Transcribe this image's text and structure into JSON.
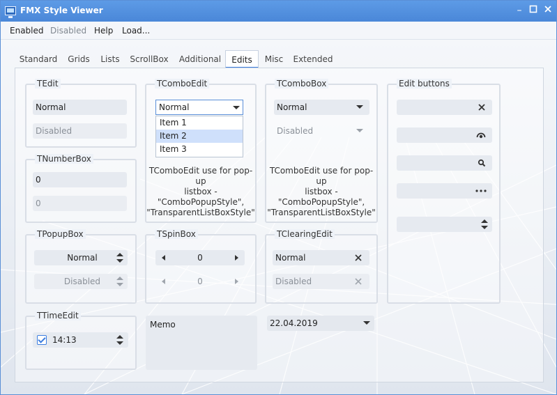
{
  "window": {
    "title": "FMX Style Viewer"
  },
  "menu": [
    "Enabled",
    "Disabled",
    "Help",
    "Load..."
  ],
  "tabs": [
    "Standard",
    "Grids",
    "Lists",
    "ScrollBox",
    "Additional",
    "Edits",
    "Misc",
    "Extended"
  ],
  "active_tab": "Edits",
  "groups": {
    "tedit": {
      "title": "TEdit",
      "normal": "Normal",
      "disabled": "Disabled"
    },
    "tnumberbox": {
      "title": "TNumberBox",
      "value1": "0",
      "value2": "0"
    },
    "tcomboedit": {
      "title": "TComboEdit",
      "value": "Normal",
      "items": [
        "Item 1",
        "Item 2",
        "Item 3"
      ],
      "selected": "Item 2",
      "caption": [
        "TComboEdit use for pop-up",
        "listbox -",
        "\"ComboPopupStyle\",",
        "\"TransparentListBoxStyle\""
      ]
    },
    "tcombobox": {
      "title": "TComboBox",
      "normal": "Normal",
      "disabled": "Disabled",
      "caption": [
        "TComboEdit use for pop-up",
        "listbox -",
        "\"ComboPopupStyle\",",
        "\"TransparentListBoxStyle\""
      ]
    },
    "editbuttons": {
      "title": "Edit buttons"
    },
    "tpopupbox": {
      "title": "TPopupBox",
      "normal": "Normal",
      "disabled": "Disabled"
    },
    "tspinbox": {
      "title": "TSpinBox",
      "value1": "0",
      "value2": "0"
    },
    "tclearingedit": {
      "title": "TClearingEdit",
      "normal": "Normal",
      "disabled": "Disabled"
    },
    "ttimeedit": {
      "title": "TTimeEdit",
      "value": "14:13",
      "checked": true
    }
  },
  "memo": {
    "text": "Memo"
  },
  "date_edit": {
    "value": "22.04.2019"
  },
  "colors": {
    "accent": "#3d7ee0",
    "titlebar": "#4a87d8"
  },
  "icons": {
    "close": "✕",
    "clear": "✕",
    "search": "search-icon",
    "ellipsis": "⋯"
  }
}
